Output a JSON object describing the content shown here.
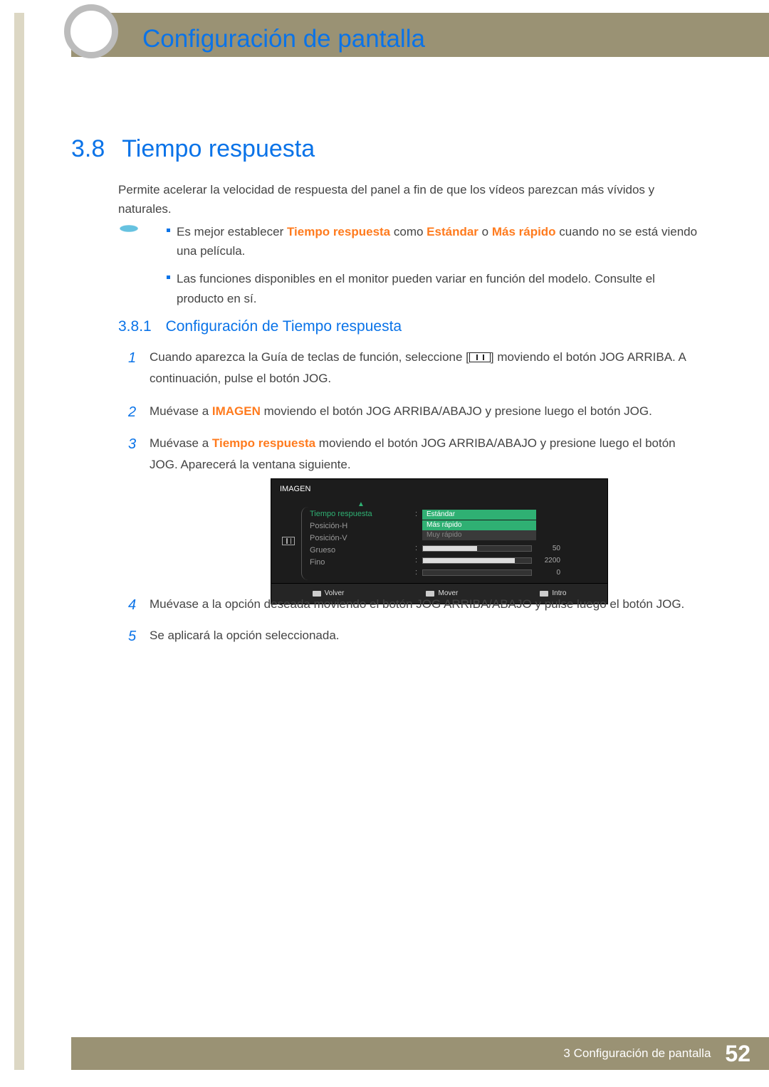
{
  "header": {
    "title": "Configuración de pantalla"
  },
  "section": {
    "number": "3.8",
    "title": "Tiempo respuesta"
  },
  "intro": "Permite acelerar la velocidad de respuesta del panel a fin de que los vídeos parezcan más vívidos y naturales.",
  "notes": {
    "items": [
      {
        "pre": "Es mejor establecer ",
        "em1": "Tiempo respuesta",
        "mid1": " como ",
        "em2": "Estándar",
        "mid2": " o ",
        "em3": "Más rápido",
        "post": " cuando no se está viendo una película."
      },
      {
        "text": "Las funciones disponibles en el monitor pueden variar en función del modelo. Consulte el producto en sí."
      }
    ]
  },
  "subsection": {
    "number": "3.8.1",
    "title": "Configuración de Tiempo respuesta"
  },
  "steps": {
    "s1a": "Cuando aparezca la Guía de teclas de función, seleccione [",
    "s1b": "] moviendo el botón JOG ARRIBA. A continuación, pulse el botón JOG.",
    "s2a": "Muévase a ",
    "s2em": "IMAGEN",
    "s2b": " moviendo el botón JOG ARRIBA/ABAJO y presione luego el botón JOG.",
    "s3a": "Muévase a ",
    "s3em": "Tiempo respuesta",
    "s3b": " moviendo el botón JOG ARRIBA/ABAJO y presione luego el botón JOG. Aparecerá la ventana siguiente.",
    "s4": "Muévase a la opción deseada moviendo el botón JOG ARRIBA/ABAJO y pulse luego el botón JOG.",
    "s5": "Se aplicará la opción seleccionada."
  },
  "osd": {
    "title": "IMAGEN",
    "menu": {
      "tiempo": "Tiempo respuesta",
      "posh": "Posición-H",
      "posv": "Posición-V",
      "grueso": "Grueso",
      "fino": "Fino"
    },
    "options": {
      "estandar": "Estándar",
      "masrapido": "Más rápido",
      "muyrapido": "Muy rápido"
    },
    "values": {
      "posh": "50",
      "grueso": "2200",
      "fino": "0",
      "posh_pct": 50,
      "grueso_pct": 85,
      "fino_pct": 0
    },
    "footer": {
      "volver": "Volver",
      "mover": "Mover",
      "intro": "Intro"
    }
  },
  "footer": {
    "chapter": "3 Configuración de pantalla",
    "page": "52"
  }
}
